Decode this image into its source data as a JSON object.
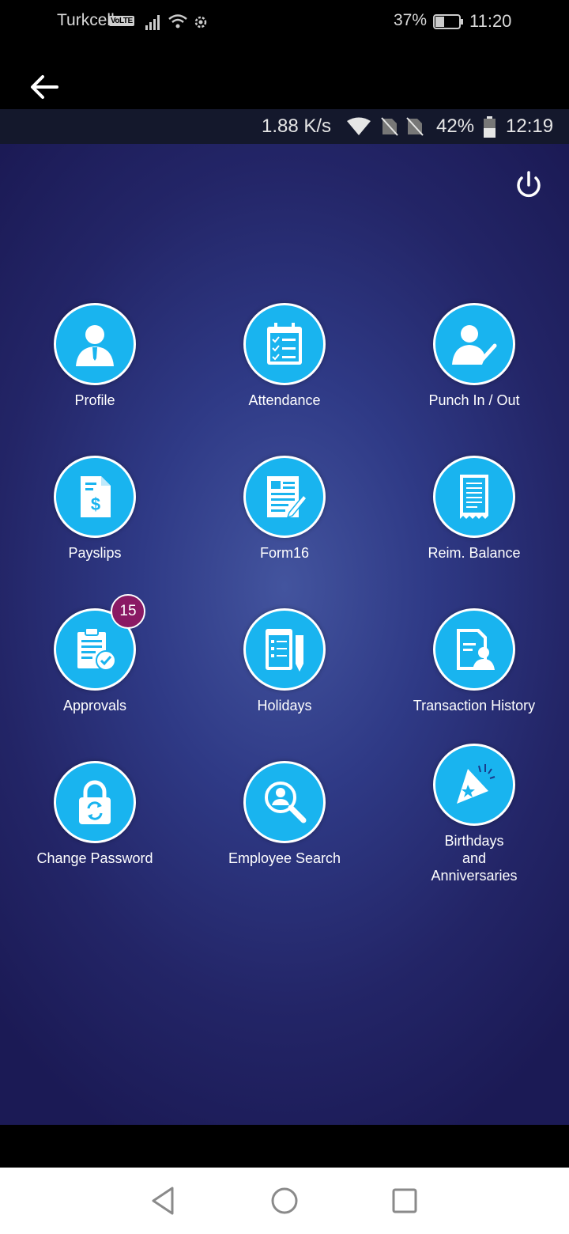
{
  "outer_status": {
    "carrier": "Turkcell",
    "volte": "VoLTE",
    "battery_pct": "37%",
    "time": "11:20"
  },
  "inner_status": {
    "net_speed": "1.88 K/s",
    "battery_pct": "42%",
    "time": "12:19"
  },
  "colors": {
    "tile_fill": "#19b4ef",
    "badge": "#8a1a64",
    "background": "#2f3a86"
  },
  "menu": [
    {
      "label": "Profile",
      "icon": "person-icon"
    },
    {
      "label": "Attendance",
      "icon": "calendar-checklist-icon"
    },
    {
      "label": "Punch In / Out",
      "icon": "person-check-icon"
    },
    {
      "label": "Payslips",
      "icon": "dollar-document-icon"
    },
    {
      "label": "Form16",
      "icon": "form-document-icon"
    },
    {
      "label": "Reim. Balance",
      "icon": "receipt-icon"
    },
    {
      "label": "Approvals",
      "icon": "clipboard-check-icon",
      "badge": "15"
    },
    {
      "label": "Holidays",
      "icon": "list-pen-icon"
    },
    {
      "label": "Transaction History",
      "icon": "document-person-icon"
    },
    {
      "label": "Change Password",
      "icon": "lock-refresh-icon"
    },
    {
      "label": "Employee Search",
      "icon": "person-search-icon"
    },
    {
      "label": "Birthdays and Anniversaries",
      "label_lines": [
        "Birthdays",
        "and",
        "Anniversaries"
      ],
      "icon": "party-popper-icon"
    }
  ]
}
